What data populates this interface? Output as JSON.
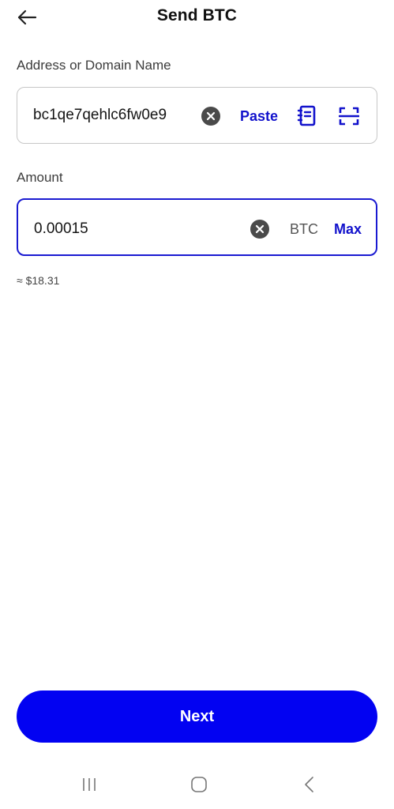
{
  "header": {
    "title": "Send BTC",
    "back_icon": "arrow-left-icon"
  },
  "address": {
    "label": "Address or Domain Name",
    "value": "bc1qe7qehlc6fw0e9",
    "paste_label": "Paste",
    "clear_icon": "close-circle-icon",
    "address_book_icon": "address-book-icon",
    "scan_icon": "scan-icon"
  },
  "amount": {
    "label": "Amount",
    "value": "0.00015",
    "unit": "BTC",
    "max_label": "Max",
    "clear_icon": "close-circle-icon",
    "fiat_estimate": "≈ $18.31"
  },
  "actions": {
    "next_label": "Next"
  },
  "navbar": {
    "items": [
      "recents-icon",
      "home-icon",
      "back-icon"
    ]
  },
  "colors": {
    "accent": "#0202f2",
    "link": "#1212cc",
    "focus_border": "#1a1ad1"
  }
}
